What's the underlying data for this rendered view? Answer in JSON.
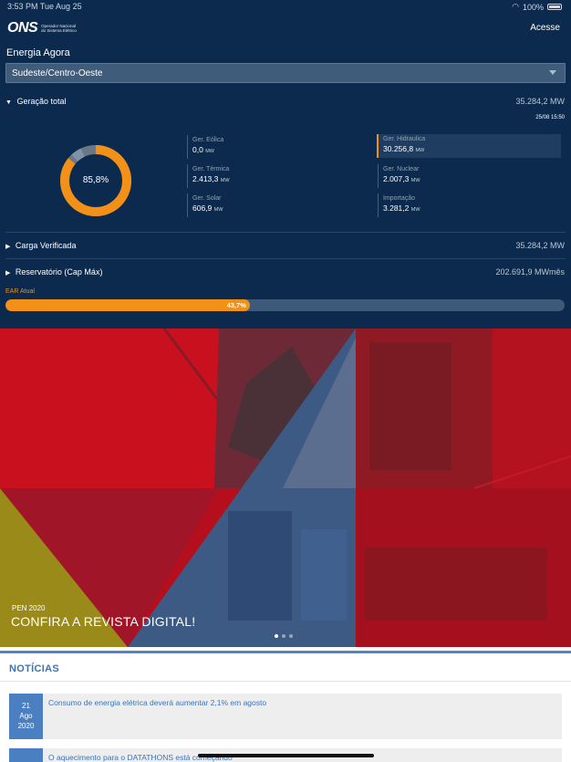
{
  "status": {
    "time": "3:53 PM",
    "date": "Tue Aug 25",
    "battery": "100%"
  },
  "header": {
    "logo_mark": "ONS",
    "logo_text": "Operador Nacional do Sistema Elétrico",
    "login_label": "Acesse"
  },
  "energia": {
    "title": "Energia Agora",
    "region": "Sudeste/Centro-Oeste",
    "geracao": {
      "label": "Geração total",
      "value": "35.284,2 MW",
      "timestamp": "25/08 15:50",
      "donut_center": "85,8%",
      "donut_share": 0.858,
      "colors": {
        "accent": "#f39017",
        "ring_gray": "#6b7784",
        "ring_light": "#7f93a8",
        "navy": "#0c2a4d"
      },
      "items": [
        {
          "label": "Ger. Eólica",
          "value": "0,0",
          "unit": "MW"
        },
        {
          "label": "Ger. Hidraulica",
          "value": "30.256,8",
          "unit": "MW"
        },
        {
          "label": "Ger. Térmica",
          "value": "2.413,3",
          "unit": "MW"
        },
        {
          "label": "Ger. Nuclear",
          "value": "2.007,3",
          "unit": "MW"
        },
        {
          "label": "Ger. Solar",
          "value": "606,9",
          "unit": "MW"
        },
        {
          "label": "Importação",
          "value": "3.281,2",
          "unit": "MW"
        }
      ]
    },
    "carga": {
      "label": "Carga Verificada",
      "value": "35.284,2 MW"
    },
    "reservatorio": {
      "label": "Reservatório (Cap Máx)",
      "value": "202.691,9 MWmês"
    },
    "ear": {
      "label": "EAR Atual",
      "percent_text": "43,7%",
      "fraction": 0.437
    }
  },
  "hero": {
    "subtitle": "PEN 2020",
    "title": "CONFIRA A REVISTA DIGITAL!",
    "slides": 3,
    "active_slide": 0
  },
  "news": {
    "title": "NOTÍCIAS",
    "items": [
      {
        "day": "21",
        "month": "Ago",
        "year": "2020",
        "headline": "Consumo de energia elétrica deverá aumentar 2,1% em agosto"
      },
      {
        "day": "",
        "month": "",
        "year": "",
        "headline": "O aquecimento para o DATATHONS está começando"
      }
    ]
  }
}
